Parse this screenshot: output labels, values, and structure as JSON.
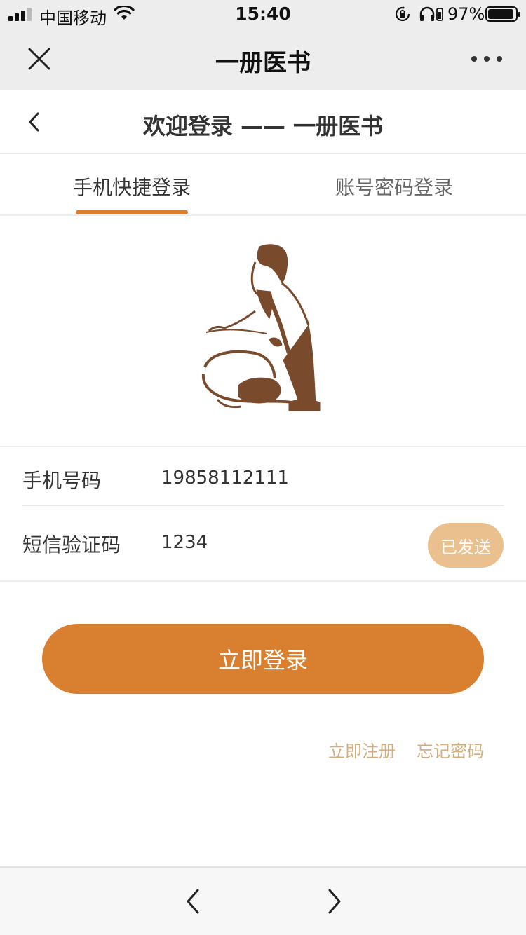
{
  "status_bar": {
    "carrier": "中国移动",
    "time": "15:40",
    "battery_percent": "97%",
    "battery_level": 0.97,
    "icons": [
      "signal-icon",
      "wifi-icon",
      "rotation-lock-icon",
      "headphones-icon",
      "battery-icon"
    ]
  },
  "wechat_bar": {
    "title": "一册医书",
    "close_icon": "close-icon",
    "more_icon": "more-icon"
  },
  "header": {
    "title": "欢迎登录 —— 一册医书",
    "back_icon": "chevron-left-icon"
  },
  "tabs": [
    {
      "label": "手机快捷登录",
      "active": true
    },
    {
      "label": "账号密码登录",
      "active": false
    }
  ],
  "form": {
    "phone": {
      "label": "手机号码",
      "value": "19858112111"
    },
    "code": {
      "label": "短信验证码",
      "value": "1234",
      "send_button": "已发送"
    }
  },
  "login_button": "立即登录",
  "links": {
    "register": "立即注册",
    "forgot": "忘记密码"
  },
  "colors": {
    "accent": "#d8802f",
    "send_button": "#ebc08f",
    "link": "#d4ad7e",
    "logo": "#7a4a2c"
  }
}
